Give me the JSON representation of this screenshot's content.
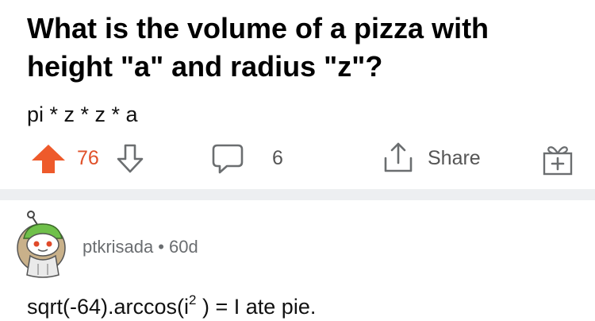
{
  "post": {
    "title": "What is the volume of a pizza with height \"a\" and radius \"z\"?",
    "body": "pi * z * z * a"
  },
  "actions": {
    "score": "76",
    "comment_count": "6",
    "share_label": "Share",
    "upvote_color": "#ee5a2b",
    "icon_color": "#6b6e70"
  },
  "comment": {
    "author": "ptkrisada",
    "separator": "•",
    "age": "60d",
    "body_before": "sqrt(-64).arccos(i",
    "body_sup": "2",
    "body_after": " ) = I ate pie."
  }
}
